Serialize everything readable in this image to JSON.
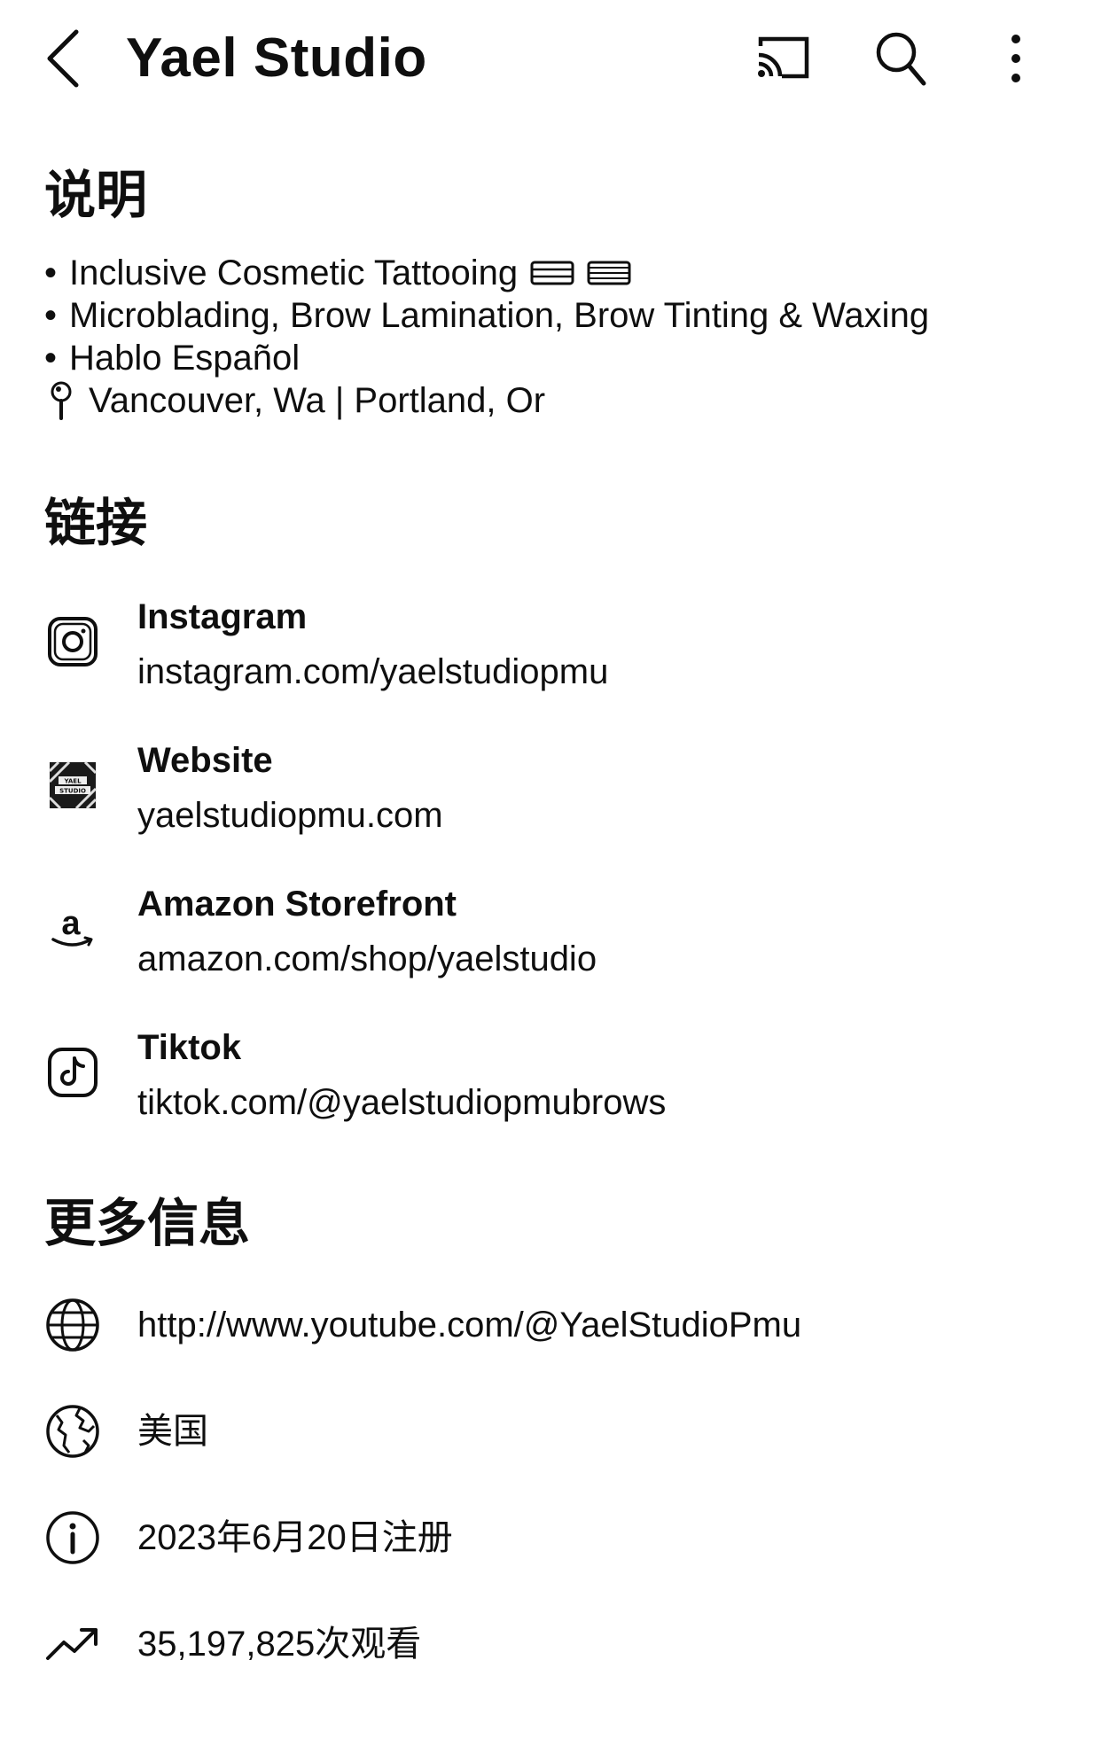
{
  "header": {
    "title": "Yael Studio",
    "back_icon": "chevron-left-icon",
    "cast_icon": "cast-icon",
    "search_icon": "search-icon",
    "more_icon": "more-vertical-icon"
  },
  "description": {
    "heading": "说明",
    "lines": [
      "Inclusive Cosmetic Tattooing",
      "Microblading, Brow Lamination, Brow Tinting & Waxing",
      "Hablo Español",
      "Vancouver, Wa | Portland, Or"
    ],
    "bullet": "•"
  },
  "links": {
    "heading": "链接",
    "items": [
      {
        "name": "Instagram",
        "url": "instagram.com/yaelstudiopmu",
        "icon": "instagram-icon"
      },
      {
        "name": "Website",
        "url": "yaelstudiopmu.com",
        "icon": "website-favicon-icon"
      },
      {
        "name": "Amazon Storefront",
        "url": "amazon.com/shop/yaelstudio",
        "icon": "amazon-icon"
      },
      {
        "name": "Tiktok",
        "url": "tiktok.com/@yaelstudiopmubrows",
        "icon": "tiktok-icon"
      }
    ]
  },
  "more_info": {
    "heading": "更多信息",
    "items": [
      {
        "text": "http://www.youtube.com/@YaelStudioPmu",
        "icon": "globe-icon"
      },
      {
        "text": "美国",
        "icon": "earth-icon"
      },
      {
        "text": "2023年6月20日注册",
        "icon": "info-icon"
      },
      {
        "text": "35,197,825次观看",
        "icon": "trending-up-icon"
      }
    ]
  }
}
